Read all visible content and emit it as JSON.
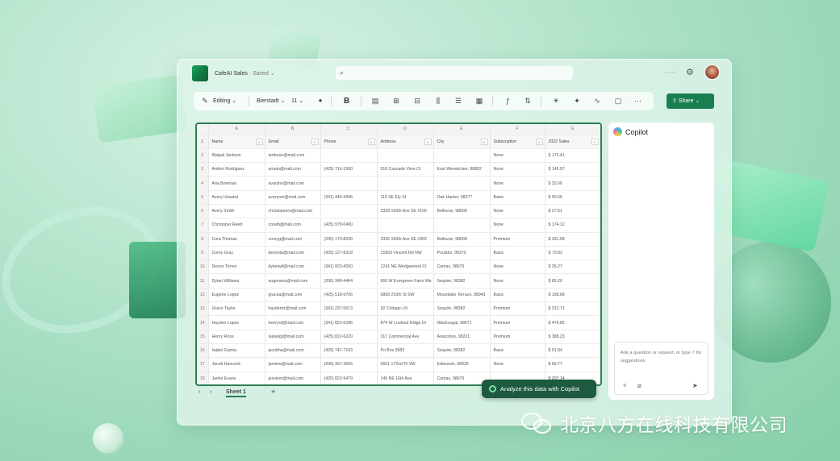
{
  "title_bar": {
    "doc_name": "CafeAI Sales",
    "saved_status": "· Saved ⌄",
    "more_label": "···"
  },
  "ribbon": {
    "mode": "Editing",
    "font_name": "Bierstadt",
    "font_size": "11",
    "bold_label": "B",
    "more_label": "···"
  },
  "share": {
    "label": "Share"
  },
  "sheet": {
    "column_letters": [
      "A",
      "B",
      "C",
      "D",
      "E",
      "F",
      "G"
    ],
    "headers": [
      "Name",
      "Email",
      "Phone",
      "Address",
      "City",
      "Subscription",
      "2022 Sales"
    ],
    "row_numbers": [
      "1",
      "2",
      "3",
      "4",
      "5",
      "6",
      "7",
      "8",
      "9",
      "10",
      "11",
      "12",
      "13",
      "14",
      "15",
      "16",
      "17",
      "18"
    ],
    "rows": [
      [
        "Abigail Jackson",
        "ambooo@mail.com",
        "",
        "",
        "",
        "None",
        "$ 173.41"
      ],
      [
        "Amber Rodriguez",
        "amato@mail.com",
        "(425) 716-1560",
        "510 Cascade View Ct",
        "East Wenatchee, 98802",
        "None",
        "$ 145.97"
      ],
      [
        "Ana Bowman",
        "avaryho@mail.com",
        "",
        "",
        "",
        "None",
        "$ 32.66"
      ],
      [
        "Avery Howard",
        "averyom@mail.com",
        "(341) 446-4946",
        "110 SE Ely St",
        "Oak Harbor, 98277",
        "Basic",
        "$ 90.66"
      ],
      [
        "Avery Smith",
        "christopoero@mail.com",
        "",
        "3328 160th Ave SE #100",
        "Bellevue, 98008",
        "None",
        "$ 27.51"
      ],
      [
        "Christoper Reed",
        "corath@mail.com",
        "(425) 978-0490",
        "",
        "",
        "None",
        "$ 174.12"
      ],
      [
        "Cora Thomas",
        "coreyg@mail.com",
        "(205) 170-8530",
        "3326 160th Ave SE #303",
        "Bellevue, 98008",
        "Premium",
        "$ 331.08"
      ],
      [
        "Corey Gray",
        "devonta@mail.com",
        "(425) 127-8318",
        "15903 Vincent Rd NW",
        "Poulsbo, 98370",
        "Basic",
        "$ 73.83"
      ],
      [
        "Devon Torres",
        "dylanwil@mail.com",
        "(341) 823-4550",
        "1241 NE Wedgewood Ct",
        "Camas, 98670",
        "None",
        "$ 35.27"
      ],
      [
        "Dylan Williams",
        "eugeneza@mail.com",
        "(206) 348-4464",
        "660 W Evergreen Farm Wa",
        "Sequim, 98382",
        "None",
        "$ 65.20"
      ],
      [
        "Eugene Lopez",
        "gracea@mail.com",
        "(425) 518-9706",
        "6808 216th St SW",
        "Mountlake Terrace, 98043",
        "Basic",
        "$ 158.68"
      ],
      [
        "Grace Taylor",
        "haydentz@mail.com",
        "(341) 237-5613",
        "92 Cottage LN",
        "Sequim, 98382",
        "Premium",
        "$ 312.71"
      ],
      [
        "Hayden Lopez",
        "henryrd@mail.com",
        "(341) 822-6286",
        "874 W Lookout Ridge Dr",
        "Washougal, 98671",
        "Premium",
        "$ 476.85"
      ],
      [
        "Henry Ross",
        "isabelgt@mail.com",
        "(425) 822-6220",
        "317 Commercial Ave",
        "Anacortes, 98221",
        "Premium",
        "$ 388.23"
      ],
      [
        "Isabel Garcia",
        "jacobha@mail.com",
        "(425) 747-7163",
        "Po Box 3682",
        "Sequim, 98382",
        "Basic",
        "$ 51.84"
      ],
      [
        "Jacob Hancock",
        "jamiew@mail.com",
        "(206) 307-3665",
        "6601 172nd Pl SW",
        "Edmonds, 98026",
        "None",
        "$ 69.77"
      ],
      [
        "Jamie Evans",
        "jessiem@mail.com",
        "(425) 823-9479",
        "145 NE 16th Ave",
        "Camas, 98670",
        "",
        "$ 207.14"
      ]
    ]
  },
  "tabs": {
    "prev": "‹",
    "next": "›",
    "active": "Sheet 1",
    "add": "+"
  },
  "analyze_button": {
    "label": "Analyze this data with Copilot"
  },
  "copilot": {
    "title": "Copilot",
    "placeholder": "Ask a question or request, or type '/' for suggestions"
  },
  "watermark": {
    "text": "北京八方在线科技有限公司"
  },
  "colors": {
    "accent": "#1a7f50",
    "selection_border": "#2f7d54",
    "cta_bg": "#1d5a3f"
  },
  "icons": [
    "search-icon",
    "gear-icon",
    "pencil-icon",
    "chevron-down-icon",
    "font-color-icon",
    "send-icon",
    "attach-icon",
    "sparkle-icon",
    "wechat-logo"
  ]
}
